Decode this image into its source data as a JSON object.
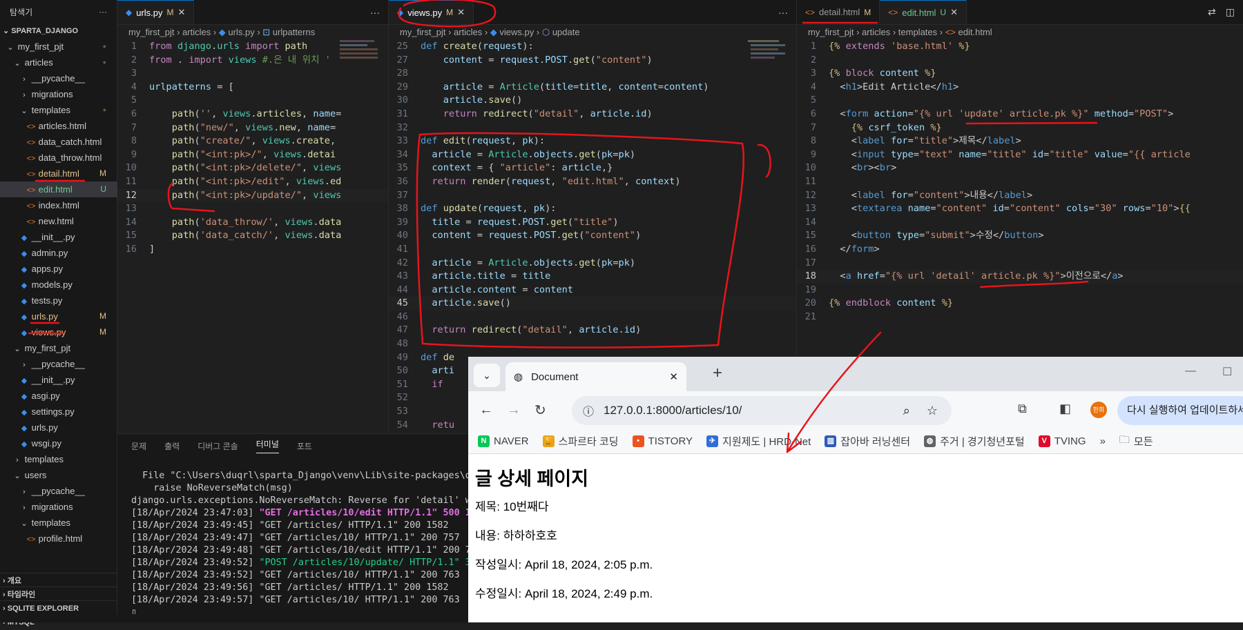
{
  "sidebar": {
    "title": "탐색기",
    "more_icon": "ellipsis-icon",
    "root": "SPARTA_DJANGO",
    "items": [
      {
        "label": "my_first_pjt",
        "type": "folder-open",
        "indent": 1,
        "status": "dot"
      },
      {
        "label": "articles",
        "type": "folder-open",
        "indent": 2,
        "status": "dot"
      },
      {
        "label": "__pycache__",
        "type": "folder",
        "indent": 3,
        "status": ""
      },
      {
        "label": "migrations",
        "type": "folder",
        "indent": 3,
        "status": ""
      },
      {
        "label": "templates",
        "type": "folder-open",
        "indent": 3,
        "status": "dot"
      },
      {
        "label": "articles.html",
        "type": "html",
        "indent": 4,
        "status": ""
      },
      {
        "label": "data_catch.html",
        "type": "html",
        "indent": 4,
        "status": ""
      },
      {
        "label": "data_throw.html",
        "type": "html",
        "indent": 4,
        "status": ""
      },
      {
        "label": "detail.html",
        "type": "html",
        "indent": 4,
        "status": "M"
      },
      {
        "label": "edit.html",
        "type": "html",
        "indent": 4,
        "status": "U"
      },
      {
        "label": "index.html",
        "type": "html",
        "indent": 4,
        "status": ""
      },
      {
        "label": "new.html",
        "type": "html",
        "indent": 4,
        "status": ""
      },
      {
        "label": "__init__.py",
        "type": "py",
        "indent": 3,
        "status": ""
      },
      {
        "label": "admin.py",
        "type": "py",
        "indent": 3,
        "status": ""
      },
      {
        "label": "apps.py",
        "type": "py",
        "indent": 3,
        "status": ""
      },
      {
        "label": "models.py",
        "type": "py",
        "indent": 3,
        "status": ""
      },
      {
        "label": "tests.py",
        "type": "py",
        "indent": 3,
        "status": ""
      },
      {
        "label": "urls.py",
        "type": "py",
        "indent": 3,
        "status": "M"
      },
      {
        "label": "views.py",
        "type": "py",
        "indent": 3,
        "status": "M"
      },
      {
        "label": "my_first_pjt",
        "type": "folder-open",
        "indent": 2,
        "status": ""
      },
      {
        "label": "__pycache__",
        "type": "folder",
        "indent": 3,
        "status": ""
      },
      {
        "label": "__init__.py",
        "type": "py",
        "indent": 3,
        "status": ""
      },
      {
        "label": "asgi.py",
        "type": "py",
        "indent": 3,
        "status": ""
      },
      {
        "label": "settings.py",
        "type": "py",
        "indent": 3,
        "status": ""
      },
      {
        "label": "urls.py",
        "type": "py",
        "indent": 3,
        "status": ""
      },
      {
        "label": "wsgi.py",
        "type": "py",
        "indent": 3,
        "status": ""
      },
      {
        "label": "templates",
        "type": "folder",
        "indent": 2,
        "status": ""
      },
      {
        "label": "users",
        "type": "folder-open",
        "indent": 2,
        "status": ""
      },
      {
        "label": "__pycache__",
        "type": "folder",
        "indent": 3,
        "status": ""
      },
      {
        "label": "migrations",
        "type": "folder",
        "indent": 3,
        "status": ""
      },
      {
        "label": "templates",
        "type": "folder-open",
        "indent": 3,
        "status": ""
      },
      {
        "label": "profile.html",
        "type": "html",
        "indent": 4,
        "status": ""
      }
    ],
    "sections": [
      "개요",
      "타임라인",
      "SQLITE EXPLORER",
      "MYSQL"
    ]
  },
  "editors": {
    "urls": {
      "tab": "urls.py",
      "status": "M",
      "crumbs": [
        "my_first_pjt",
        "articles",
        "urls.py",
        "urlpatterns"
      ],
      "lines": [
        {
          "n": "1",
          "h": "<span class='kw'>from</span> <span class='cls'>django</span>.<span class='cls'>urls</span> <span class='kw'>import</span> <span class='fn'>path</span>"
        },
        {
          "n": "2",
          "h": "<span class='kw'>from</span> . <span class='kw'>import</span> <span class='cls'>views</span> <span class='cm'>#.은 내 위치 '</span>"
        },
        {
          "n": "3",
          "h": ""
        },
        {
          "n": "4",
          "h": "<span class='va'>urlpatterns</span> = ["
        },
        {
          "n": "5",
          "h": ""
        },
        {
          "n": "6",
          "h": "    <span class='fn'>path</span>(<span class='str'>''</span>, <span class='cls'>views</span>.<span class='fn'>articles</span>, <span class='va'>name</span>="
        },
        {
          "n": "7",
          "h": "    <span class='fn'>path</span>(<span class='str'>\"new/\"</span>, <span class='cls'>views</span>.<span class='fn'>new</span>, <span class='va'>name</span>="
        },
        {
          "n": "8",
          "h": "    <span class='fn'>path</span>(<span class='str'>\"create/\"</span>, <span class='cls'>views</span>.<span class='fn'>create</span>,"
        },
        {
          "n": "9",
          "h": "    <span class='fn'>path</span>(<span class='str'>\"&lt;int:pk&gt;/\"</span>, <span class='cls'>views</span>.<span class='fn'>detai</span>"
        },
        {
          "n": "10",
          "h": "    <span class='fn'>path</span>(<span class='str'>\"&lt;int:pk&gt;/delete/\"</span>, <span class='cls'>views</span>"
        },
        {
          "n": "11",
          "h": "    <span class='fn'>path</span>(<span class='str'>\"&lt;int:pk&gt;/edit\"</span>, <span class='cls'>views</span>.<span class='fn'>ed</span>"
        },
        {
          "n": "12",
          "h": "    <span class='fn'>path</span>(<span class='str'>\"&lt;int:pk&gt;/update/\"</span>, <span class='cls'>views</span>",
          "cur": true
        },
        {
          "n": "13",
          "h": ""
        },
        {
          "n": "14",
          "h": "    <span class='fn'>path</span>(<span class='str'>'data_throw/'</span>, <span class='cls'>views</span>.<span class='fn'>data</span>"
        },
        {
          "n": "15",
          "h": "    <span class='fn'>path</span>(<span class='str'>'data_catch/'</span>, <span class='cls'>views</span>.<span class='fn'>data</span>"
        },
        {
          "n": "16",
          "h": "]"
        }
      ]
    },
    "views": {
      "tab": "views.py",
      "status": "M",
      "crumbs": [
        "my_first_pjt",
        "articles",
        "views.py",
        "update"
      ],
      "lines": [
        {
          "n": "25",
          "h": "<span class='kb'>def</span> <span class='fn'>create</span>(<span class='va'>request</span>):"
        },
        {
          "n": "27",
          "h": "    <span class='va'>content</span> = <span class='va'>request</span>.<span class='va'>POST</span>.<span class='fn'>get</span>(<span class='str'>\"content\"</span>)"
        },
        {
          "n": "28",
          "h": ""
        },
        {
          "n": "29",
          "h": "    <span class='va'>article</span> = <span class='cls'>Article</span>(<span class='va'>title</span>=<span class='va'>title</span>, <span class='va'>content</span>=<span class='va'>content</span>)"
        },
        {
          "n": "30",
          "h": "    <span class='va'>article</span>.<span class='fn'>save</span>()"
        },
        {
          "n": "31",
          "h": "    <span class='kw'>return</span> <span class='fn'>redirect</span>(<span class='str'>\"detail\"</span>, <span class='va'>article</span>.<span class='va'>id</span>)"
        },
        {
          "n": "32",
          "h": ""
        },
        {
          "n": "33",
          "h": "<span class='kb'>def</span> <span class='fn'>edit</span>(<span class='va'>request</span>, <span class='va'>pk</span>):"
        },
        {
          "n": "34",
          "h": "  <span class='va'>article</span> = <span class='cls'>Article</span>.<span class='va'>objects</span>.<span class='fn'>get</span>(<span class='va'>pk</span>=<span class='va'>pk</span>)"
        },
        {
          "n": "35",
          "h": "  <span class='va'>context</span> = { <span class='str'>\"article\"</span>: <span class='va'>article</span>,}"
        },
        {
          "n": "36",
          "h": "  <span class='kw'>return</span> <span class='fn'>render</span>(<span class='va'>request</span>, <span class='str'>\"edit.html\"</span>, <span class='va'>context</span>)"
        },
        {
          "n": "37",
          "h": ""
        },
        {
          "n": "38",
          "h": "<span class='kb'>def</span> <span class='fn'>update</span>(<span class='va'>request</span>, <span class='va'>pk</span>):"
        },
        {
          "n": "39",
          "h": "  <span class='va'>title</span> = <span class='va'>request</span>.<span class='va'>POST</span>.<span class='fn'>get</span>(<span class='str'>\"title\"</span>)"
        },
        {
          "n": "40",
          "h": "  <span class='va'>content</span> = <span class='va'>request</span>.<span class='va'>POST</span>.<span class='fn'>get</span>(<span class='str'>\"content\"</span>)"
        },
        {
          "n": "41",
          "h": ""
        },
        {
          "n": "42",
          "h": "  <span class='va'>article</span> = <span class='cls'>Article</span>.<span class='va'>objects</span>.<span class='fn'>get</span>(<span class='va'>pk</span>=<span class='va'>pk</span>)"
        },
        {
          "n": "43",
          "h": "  <span class='va'>article</span>.<span class='va'>title</span> = <span class='va'>title</span>"
        },
        {
          "n": "44",
          "h": "  <span class='va'>article</span>.<span class='va'>content</span> = <span class='va'>content</span>"
        },
        {
          "n": "45",
          "h": "  <span class='va'>article</span>.<span class='fn'>save</span>()",
          "cur": true
        },
        {
          "n": "46",
          "h": ""
        },
        {
          "n": "47",
          "h": "  <span class='kw'>return</span> <span class='fn'>redirect</span>(<span class='str'>\"detail\"</span>, <span class='va'>article</span>.<span class='va'>id</span>)"
        },
        {
          "n": "48",
          "h": ""
        },
        {
          "n": "49",
          "h": "<span class='kb'>def</span> <span class='fn'>de</span>"
        },
        {
          "n": "50",
          "h": "  <span class='va'>arti</span>"
        },
        {
          "n": "51",
          "h": "  <span class='kw'>if</span>"
        },
        {
          "n": "52",
          "h": ""
        },
        {
          "n": "53",
          "h": ""
        },
        {
          "n": "54",
          "h": "  <span class='kw'>retu</span>"
        }
      ]
    },
    "detail_tab": {
      "tab": "detail.html",
      "status": "M"
    },
    "edit": {
      "tab": "edit.html",
      "status": "U",
      "crumbs": [
        "my_first_pjt",
        "articles",
        "templates",
        "edit.html"
      ],
      "lines": [
        {
          "n": "1",
          "h": "<span class='tmpl'>{%</span> <span class='kw'>extends</span> <span class='str'>'base.html'</span> <span class='tmpl'>%}</span>"
        },
        {
          "n": "2",
          "h": ""
        },
        {
          "n": "3",
          "h": "<span class='tmpl'>{%</span> <span class='kw'>block</span> <span class='va'>content</span> <span class='tmpl'>%}</span>"
        },
        {
          "n": "4",
          "h": "  <span class='op'>&lt;</span><span class='tg'>h1</span><span class='op'>&gt;</span>Edit Article<span class='op'>&lt;/</span><span class='tg'>h1</span><span class='op'>&gt;</span>"
        },
        {
          "n": "5",
          "h": ""
        },
        {
          "n": "6",
          "h": "  <span class='op'>&lt;</span><span class='tg'>form</span> <span class='at'>action</span>=<span class='str'>\"{% url 'update' article.pk %}\"</span> <span class='at'>method</span>=<span class='str'>\"POST\"</span><span class='op'>&gt;</span>"
        },
        {
          "n": "7",
          "h": "    <span class='tmpl'>{%</span> <span class='va'>csrf_token</span> <span class='tmpl'>%}</span>"
        },
        {
          "n": "8",
          "h": "    <span class='op'>&lt;</span><span class='tg'>label</span> <span class='at'>for</span>=<span class='str'>\"title\"</span><span class='op'>&gt;</span>제목<span class='op'>&lt;/</span><span class='tg'>label</span><span class='op'>&gt;</span>"
        },
        {
          "n": "9",
          "h": "    <span class='op'>&lt;</span><span class='tg'>input</span> <span class='at'>type</span>=<span class='str'>\"text\"</span> <span class='at'>name</span>=<span class='str'>\"title\"</span> <span class='at'>id</span>=<span class='str'>\"title\"</span> <span class='at'>value</span>=<span class='str'>\"{{ article</span>"
        },
        {
          "n": "10",
          "h": "    <span class='op'>&lt;</span><span class='tg'>br</span><span class='op'>&gt;&lt;</span><span class='tg'>br</span><span class='op'>&gt;</span>"
        },
        {
          "n": "11",
          "h": ""
        },
        {
          "n": "12",
          "h": "    <span class='op'>&lt;</span><span class='tg'>label</span> <span class='at'>for</span>=<span class='str'>\"content\"</span><span class='op'>&gt;</span>내용<span class='op'>&lt;/</span><span class='tg'>label</span><span class='op'>&gt;</span>"
        },
        {
          "n": "13",
          "h": "    <span class='op'>&lt;</span><span class='tg'>textarea</span> <span class='at'>name</span>=<span class='str'>\"content\"</span> <span class='at'>id</span>=<span class='str'>\"content\"</span> <span class='at'>cols</span>=<span class='str'>\"30\"</span> <span class='at'>rows</span>=<span class='str'>\"10\"</span><span class='op'>&gt;</span><span class='tmpl'>{{</span>"
        },
        {
          "n": "14",
          "h": ""
        },
        {
          "n": "15",
          "h": "    <span class='op'>&lt;</span><span class='tg'>button</span> <span class='at'>type</span>=<span class='str'>\"submit\"</span><span class='op'>&gt;</span>수정<span class='op'>&lt;/</span><span class='tg'>button</span><span class='op'>&gt;</span>"
        },
        {
          "n": "16",
          "h": "  <span class='op'>&lt;/</span><span class='tg'>form</span><span class='op'>&gt;</span>"
        },
        {
          "n": "17",
          "h": ""
        },
        {
          "n": "18",
          "h": "  <span class='op'>&lt;</span><span class='tg'>a</span> <span class='at'>href</span>=<span class='str'>\"{% url 'detail' article.pk %}\"</span><span class='op'>&gt;</span>이전으로<span class='op'>&lt;/</span><span class='tg'>a</span><span class='op'>&gt;</span>",
          "cur": true
        },
        {
          "n": "19",
          "h": ""
        },
        {
          "n": "20",
          "h": "<span class='tmpl'>{%</span> <span class='kw'>endblock</span> <span class='va'>content</span> <span class='tmpl'>%}</span>"
        },
        {
          "n": "21",
          "h": ""
        }
      ]
    }
  },
  "terminal": {
    "tabs": [
      "문제",
      "출력",
      "디버그 콘솔",
      "터미널",
      "포트"
    ],
    "active_tab": "터미널",
    "lines": [
      {
        "t": "",
        "c": ""
      },
      {
        "t": "  File \"C:\\Users\\duqrl\\sparta_Django\\venv\\Lib\\site-packages\\d",
        "c": ""
      },
      {
        "t": "    raise NoReverseMatch(msg)",
        "c": ""
      },
      {
        "t": "django.urls.exceptions.NoReverseMatch: Reverse for 'detail' w",
        "c": ""
      },
      {
        "t": "[18/Apr/2024 23:47:03] \"GET /articles/10/edit HTTP/1.1\" 500 1",
        "c": "t500"
      },
      {
        "t": "[18/Apr/2024 23:49:45] \"GET /articles/ HTTP/1.1\" 200 1582",
        "c": ""
      },
      {
        "t": "[18/Apr/2024 23:49:47] \"GET /articles/10/ HTTP/1.1\" 200 757",
        "c": ""
      },
      {
        "t": "[18/Apr/2024 23:49:48] \"GET /articles/10/edit HTTP/1.1\" 200 7",
        "c": ""
      },
      {
        "t": "[18/Apr/2024 23:49:52] \"POST /articles/10/update/ HTTP/1.1\" 3",
        "c": "tpost"
      },
      {
        "t": "[18/Apr/2024 23:49:52] \"GET /articles/10/ HTTP/1.1\" 200 763",
        "c": ""
      },
      {
        "t": "[18/Apr/2024 23:49:56] \"GET /articles/ HTTP/1.1\" 200 1582",
        "c": ""
      },
      {
        "t": "[18/Apr/2024 23:49:57] \"GET /articles/10/ HTTP/1.1\" 200 763",
        "c": ""
      }
    ]
  },
  "browser": {
    "tab_title": "Document",
    "url": "127.0.0.1:8000/articles/10/",
    "update_button": "다시 실행하여 업데이트하세",
    "avatar": "한희",
    "bookmarks": [
      {
        "label": "NAVER",
        "color": "#03c75a",
        "glyph": "N"
      },
      {
        "label": "스파르타 코딩",
        "color": "#e8a317",
        "glyph": "🏆"
      },
      {
        "label": "TISTORY",
        "color": "#eb531f",
        "glyph": "•"
      },
      {
        "label": "지원제도 | HRD-Net",
        "color": "#2f6fd6",
        "glyph": "✈"
      },
      {
        "label": "잡아바 러닝센터",
        "color": "#2a5bb8",
        "glyph": "▥"
      },
      {
        "label": "주거 | 경기청년포털",
        "color": "#5f6368",
        "glyph": "◍"
      },
      {
        "label": "TVING",
        "color": "#e0082d",
        "glyph": "V"
      }
    ],
    "more_label": "»",
    "folder_label": "모든",
    "page": {
      "title": "글 상세 페이지",
      "fields": [
        "제목: 10번째다",
        "내용: 하하하호호",
        "작성일시: April 18, 2024, 2:05 p.m.",
        "수정일시: April 18, 2024, 2:49 p.m."
      ]
    }
  }
}
